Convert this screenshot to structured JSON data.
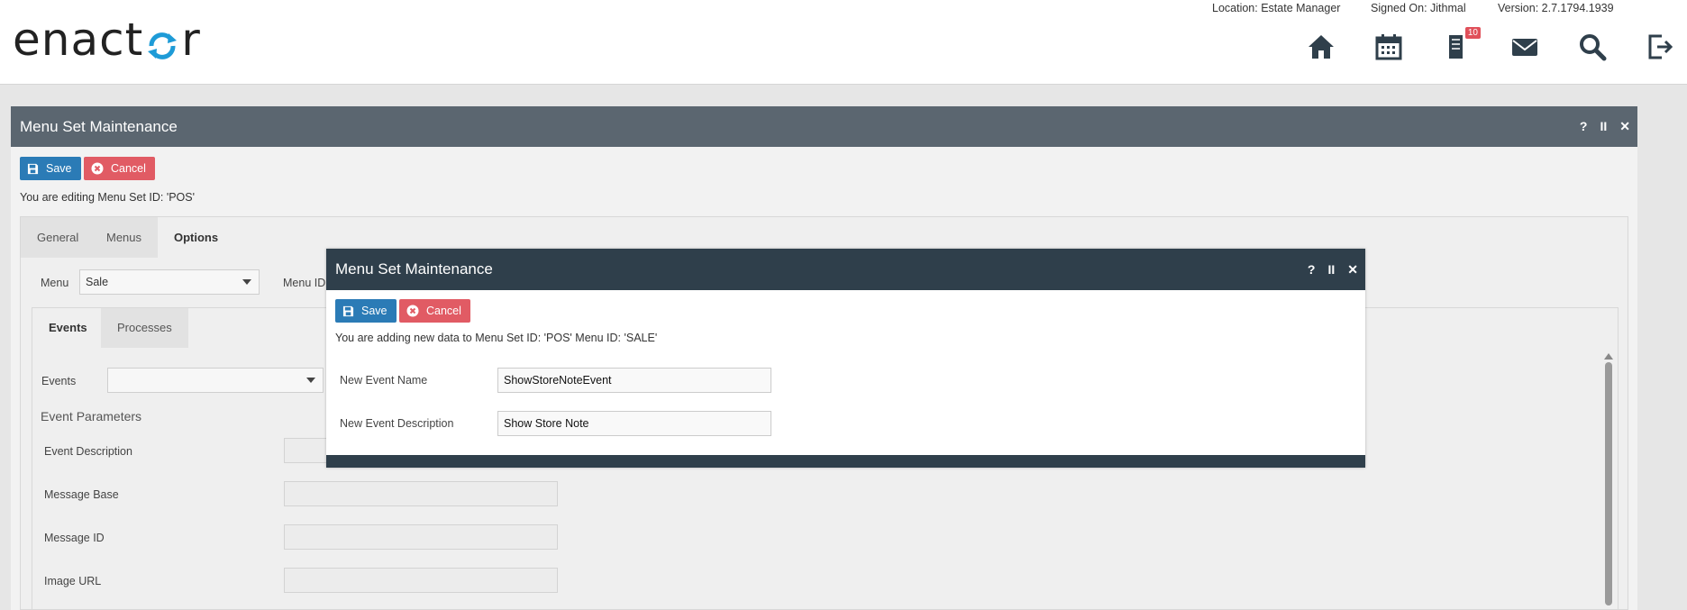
{
  "header": {
    "logo_text": "enactor",
    "location": "Location: Estate Manager",
    "signed_on": "Signed On: Jithmal",
    "version": "Version: 2.7.1794.1939",
    "notification_count": "10",
    "icons": [
      "home-icon",
      "calendar-icon",
      "documents-icon",
      "mail-icon",
      "search-icon",
      "logout-icon"
    ]
  },
  "panel": {
    "title": "Menu Set Maintenance",
    "controls": {
      "help": "?",
      "pause": "II",
      "close": "✕"
    },
    "save_label": "Save",
    "cancel_label": "Cancel",
    "editing_text": "You are editing Menu Set ID: 'POS'",
    "tabs": [
      "General",
      "Menus",
      "Options"
    ],
    "menu_label": "Menu",
    "menu_value": "Sale",
    "menu_id_label": "Menu ID",
    "subtabs": [
      "Events",
      "Processes"
    ],
    "events_label": "Events",
    "events_value": "",
    "event_parameters_heading": "Event Parameters",
    "fields": [
      "Event Description",
      "Message Base",
      "Message ID",
      "Image URL"
    ]
  },
  "modal": {
    "title": "Menu Set Maintenance",
    "controls": {
      "help": "?",
      "pause": "II",
      "close": "✕"
    },
    "save_label": "Save",
    "cancel_label": "Cancel",
    "info_text": "You are adding new data to Menu Set ID: 'POS' Menu ID: 'SALE'",
    "new_event_name_label": "New Event Name",
    "new_event_name_value": "ShowStoreNoteEvent",
    "new_event_description_label": "New Event Description",
    "new_event_description_value": "Show Store Note"
  },
  "colors": {
    "panel_header": "#5b6670",
    "modal_header": "#2f3f4b",
    "save_button": "#2b7bb6",
    "cancel_button": "#e15b64",
    "badge": "#e0505a",
    "logo_accent": "#1e9bd7"
  }
}
